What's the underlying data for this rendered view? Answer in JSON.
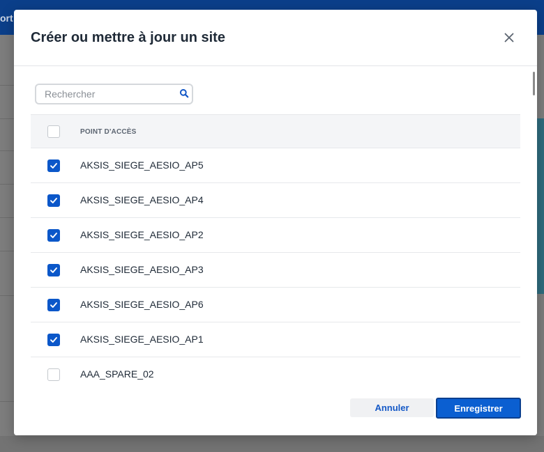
{
  "background": {
    "topbar_text": "ort"
  },
  "modal": {
    "title": "Créer ou mettre à jour un site",
    "close_icon": "close-icon"
  },
  "search": {
    "placeholder": "Rechercher",
    "value": "",
    "icon": "search-icon"
  },
  "table": {
    "header": "POINT D'ACCÈS",
    "header_checked": false,
    "rows": [
      {
        "label": "AKSIS_SIEGE_AESIO_AP5",
        "checked": true
      },
      {
        "label": "AKSIS_SIEGE_AESIO_AP4",
        "checked": true
      },
      {
        "label": "AKSIS_SIEGE_AESIO_AP2",
        "checked": true
      },
      {
        "label": "AKSIS_SIEGE_AESIO_AP3",
        "checked": true
      },
      {
        "label": "AKSIS_SIEGE_AESIO_AP6",
        "checked": true
      },
      {
        "label": "AKSIS_SIEGE_AESIO_AP1",
        "checked": true
      },
      {
        "label": "AAA_SPARE_02",
        "checked": false
      }
    ]
  },
  "footer": {
    "cancel_label": "Annuler",
    "save_label": "Enregistrer"
  },
  "colors": {
    "accent": "#0b57c9",
    "topbar": "#0b3f8a"
  }
}
